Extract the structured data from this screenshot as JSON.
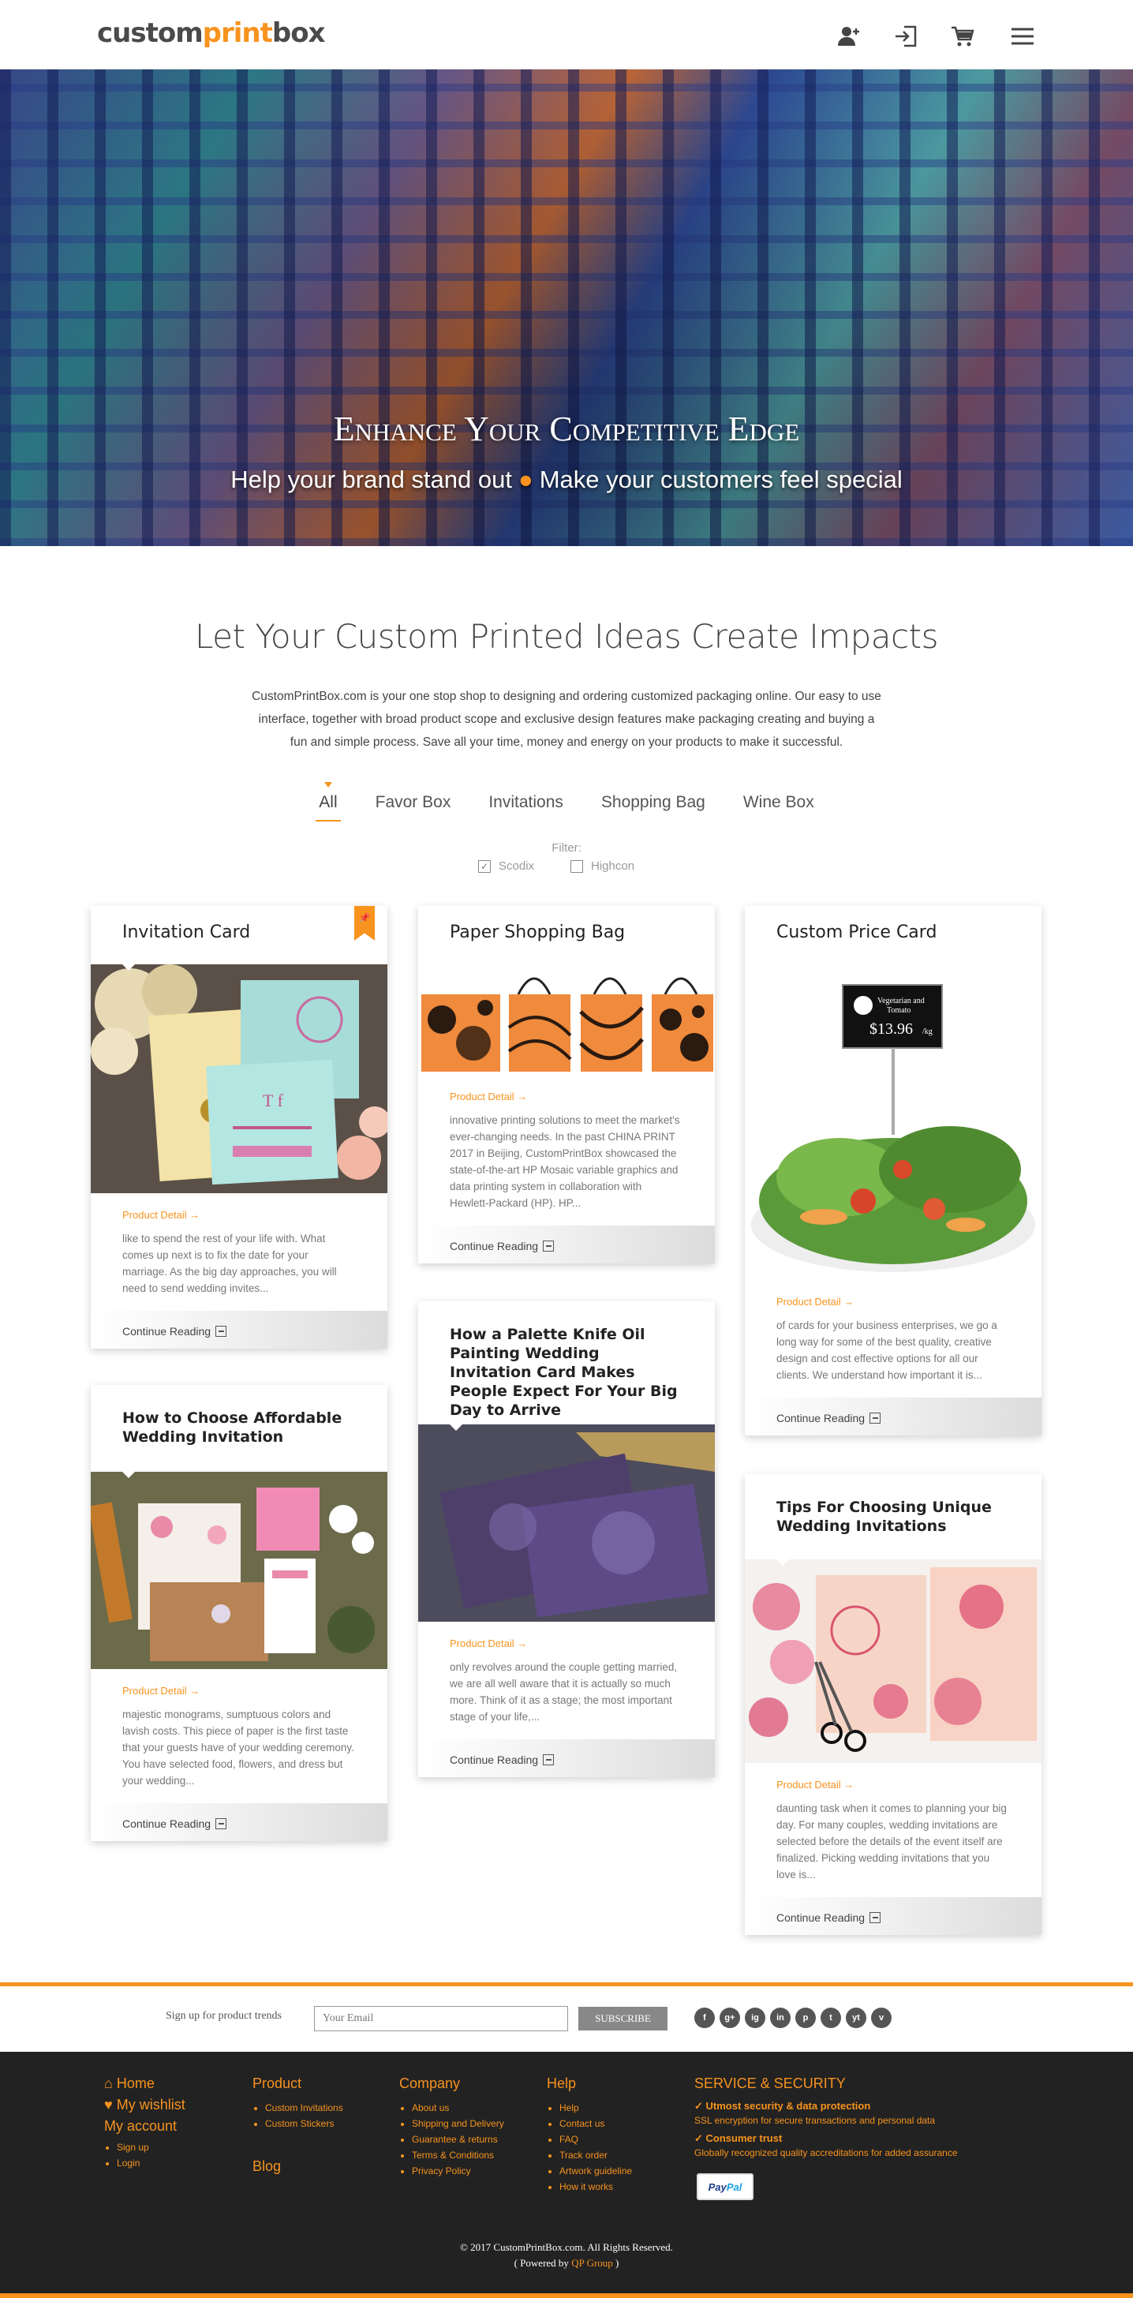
{
  "header": {
    "logo_part1": "custom",
    "logo_part2": "print",
    "logo_part3": "box",
    "icons": [
      "add-user-icon",
      "login-icon",
      "cart-icon",
      "menu-icon"
    ]
  },
  "hero": {
    "title": "Enhance Your Competitive Edge",
    "subtitle_left": "Help your brand stand out",
    "separator": "●",
    "subtitle_right": "Make your customers feel special",
    "slides_total": 3,
    "slide_active": 2
  },
  "intro": {
    "title": "Let Your Custom Printed Ideas Create Impacts",
    "text": "CustomPrintBox.com is your one stop shop to designing and ordering customized packaging online. Our easy to use interface, together with broad product scope and exclusive design features make packaging creating and buying a fun and simple process. Save all your time, money and energy on your products to make it successful."
  },
  "tabs": [
    "All",
    "Favor Box",
    "Invitations",
    "Shopping Bag",
    "Wine Box"
  ],
  "active_tab": "All",
  "filter": {
    "label": "Filter:",
    "options": [
      {
        "label": "Scodix",
        "checked": true
      },
      {
        "label": "Highcon",
        "checked": false
      }
    ]
  },
  "cards": [
    {
      "title": "Invitation Card",
      "detail": "Product Detail  →",
      "excerpt": "like to spend the rest of your life with. What comes up next is to fix the date for your marriage. As the big day approaches, you will need to send wedding invites...",
      "cta": "Continue Reading",
      "pinned": true
    },
    {
      "title": "Paper Shopping Bag",
      "detail": "Product Detail  →",
      "excerpt": "innovative printing solutions to meet the market's ever-changing needs. In the past CHINA PRINT 2017 in Beijing, CustomPrintBox showcased the state-of-the-art HP Mosaic variable graphics and data printing system in collaboration with Hewlett-Packard (HP). HP...",
      "cta": "Continue Reading"
    },
    {
      "title": "Custom Price Card",
      "detail": "Product Detail  →",
      "excerpt": "of cards for your business enterprises, we go a long way for some of the best quality, creative design and cost effective options for all our clients. We understand how important it is...",
      "cta": "Continue Reading",
      "sign_line1": "Vegetarian and",
      "sign_line2": "Tomato",
      "sign_price": "$13.96",
      "sign_unit": "/kg"
    },
    {
      "title": "How to Choose Affordable Wedding Invitation",
      "detail": "Product Detail  →",
      "excerpt": "majestic monograms, sumptuous colors and lavish costs. This piece of paper is the first taste that your guests have of your wedding ceremony. You have selected food, flowers, and dress but your wedding...",
      "cta": "Continue Reading"
    },
    {
      "title": "How a Palette Knife Oil Painting Wedding Invitation Card Makes People Expect For Your Big Day to Arrive",
      "detail": "Product Detail  →",
      "excerpt": "only revolves around the couple getting married, we are all well aware that it is actually so much more. Think of it as a stage; the most important stage of your life,...",
      "cta": "Continue Reading"
    },
    {
      "title": "Tips For Choosing Unique Wedding Invitations",
      "detail": "Product Detail  →",
      "excerpt": "daunting task when it comes to planning your big day. For many couples, wedding invitations are selected before the details of the event itself are finalized. Picking wedding invitations that you love is...",
      "cta": "Continue Reading"
    }
  ],
  "subscribe": {
    "label": "Sign up for product trends",
    "placeholder": "Your Email",
    "button": "SUBSCRIBE",
    "socials": [
      "f",
      "g+",
      "ig",
      "in",
      "p",
      "t",
      "yt",
      "v"
    ]
  },
  "footer": {
    "home": "Home",
    "wishlist": "My wishlist",
    "account": "My account",
    "account_links": [
      "Sign up",
      "Login"
    ],
    "product": "Product",
    "product_links": [
      "Custom Invitations",
      "Custom Stickers"
    ],
    "blog": "Blog",
    "company": "Company",
    "company_links": [
      "About us",
      "Shipping and Delivery",
      "Guarantee & returns",
      "Terms & Conditions",
      "Privacy Policy"
    ],
    "help": "Help",
    "help_links": [
      "Help",
      "Contact us",
      "FAQ",
      "Track order",
      "Artwork guideline",
      "How it works"
    ],
    "security_title": "SERVICE & SECURITY",
    "sec1_title": "Utmost security & data protection",
    "sec1_desc": "SSL encryption for secure transactions and personal data",
    "sec2_title": "Consumer trust",
    "sec2_desc": "Globally recognized quality accreditations for added assurance",
    "paypal1": "Pay",
    "paypal2": "Pal",
    "copyright": "© 2017 CustomPrintBox.com. All Rights Reserved.",
    "powered_pre": "( Powered by ",
    "powered_link": "QP Group",
    "powered_post": " )"
  }
}
